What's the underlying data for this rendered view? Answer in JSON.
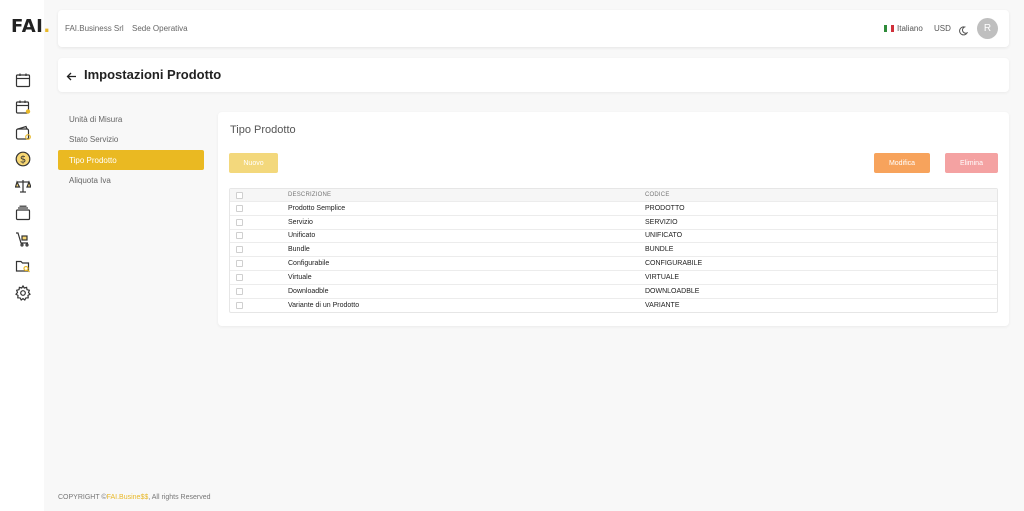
{
  "app": {
    "logo_text": "FAI",
    "logo_dot": "."
  },
  "rail": {
    "icons": [
      "calendar-icon",
      "calendar-user-icon",
      "wallet-icon",
      "dollar-icon",
      "scale-icon",
      "layers-icon",
      "cart-icon",
      "folder-search-icon",
      "settings-icon"
    ]
  },
  "header": {
    "company": "FAI.Business Srl",
    "site": "Sede Operativa",
    "language": "Italiano",
    "currency": "USD",
    "avatar_initial": "R"
  },
  "page": {
    "title": "Impostazioni Prodotto"
  },
  "submenu": {
    "items": [
      {
        "label": "Unità di Misura"
      },
      {
        "label": "Stato Servizio"
      },
      {
        "label": "Tipo Prodotto"
      },
      {
        "label": "Aliquota Iva"
      }
    ],
    "active_index": 2
  },
  "card": {
    "title": "Tipo Prodotto",
    "buttons": {
      "new": "Nuovo",
      "edit": "Modifica",
      "delete": "Elimina"
    },
    "columns": [
      "DESCRIZIONE",
      "CODICE"
    ],
    "rows": [
      {
        "descrizione": "Prodotto Semplice",
        "codice": "PRODOTTO"
      },
      {
        "descrizione": "Servizio",
        "codice": "SERVIZIO"
      },
      {
        "descrizione": "Unificato",
        "codice": "UNIFICATO"
      },
      {
        "descrizione": "Bundle",
        "codice": "BUNDLE"
      },
      {
        "descrizione": "Configurabile",
        "codice": "CONFIGURABILE"
      },
      {
        "descrizione": "Virtuale",
        "codice": "VIRTUALE"
      },
      {
        "descrizione": "Downloadble",
        "codice": "DOWNLOADBLE"
      },
      {
        "descrizione": "Variante di un Prodotto",
        "codice": "VARIANTE"
      }
    ]
  },
  "footer": {
    "prefix": "COPYRIGHT ©",
    "brand": "FAI.Busine$$",
    "suffix": ", All rights Reserved"
  },
  "colors": {
    "accent": "#eab922",
    "edit": "#f7a35c",
    "delete": "#f4a2a2",
    "new": "#f3d87c"
  }
}
